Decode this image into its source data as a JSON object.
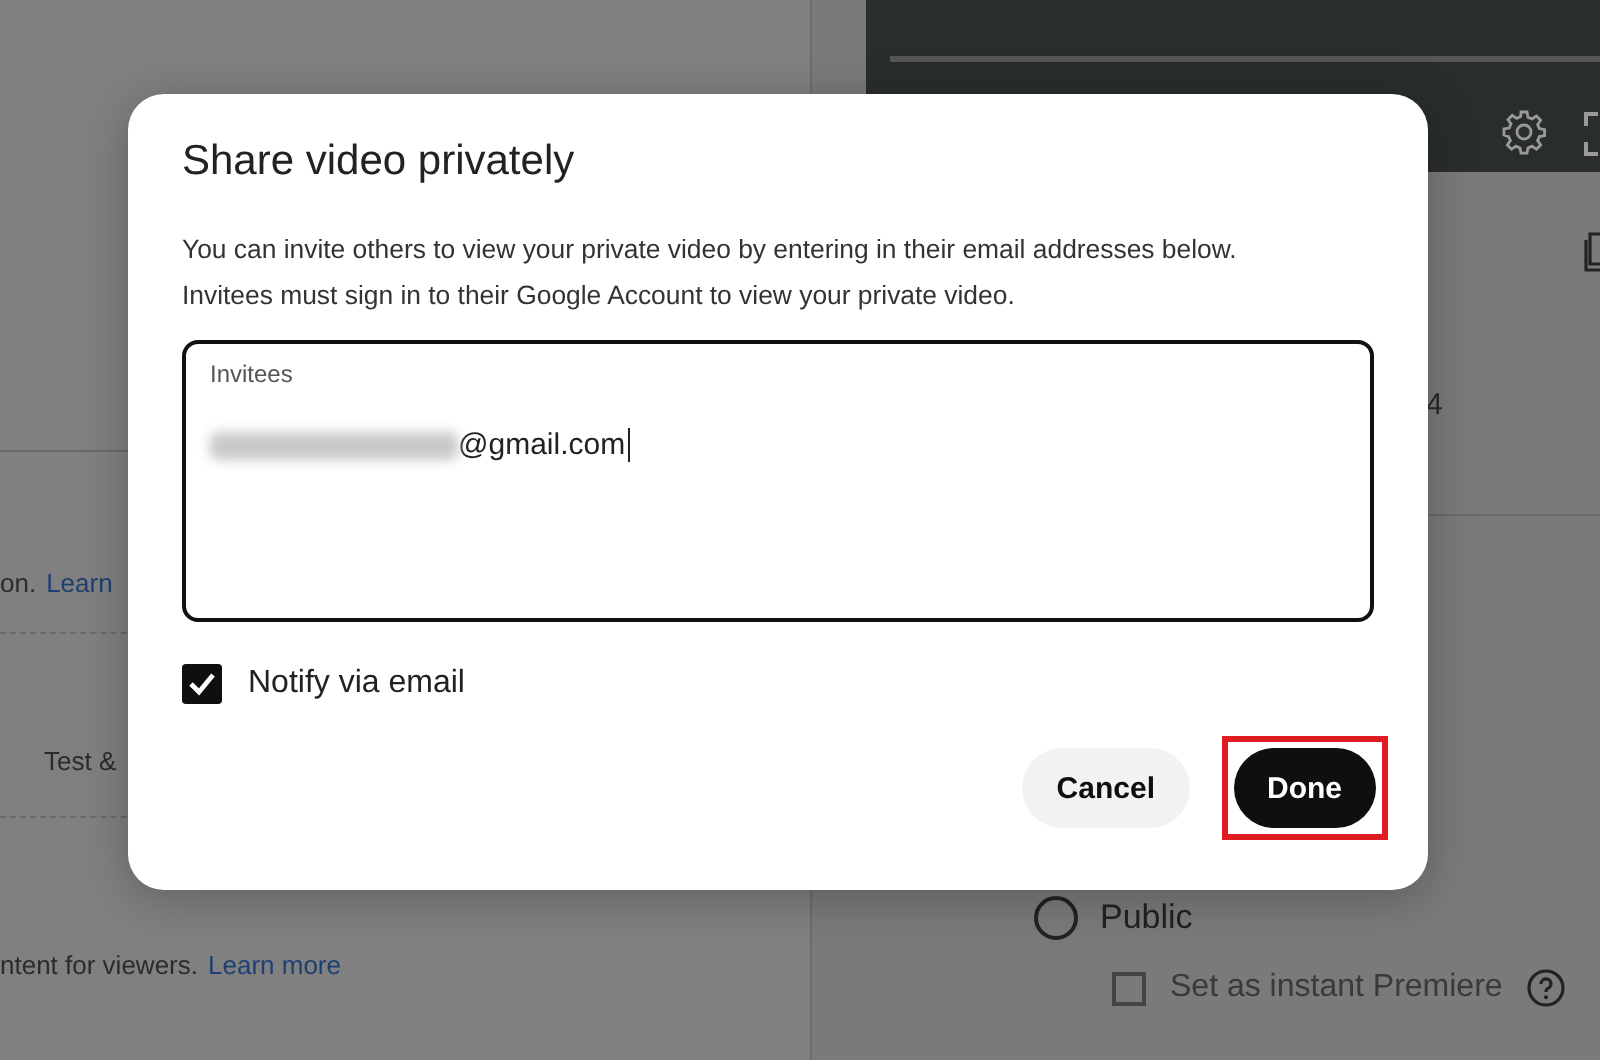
{
  "background": {
    "left": {
      "learn_snippet": {
        "text": "on.",
        "link": "Learn"
      },
      "test_label": "Test &",
      "footer": {
        "text": "ntent for viewers.",
        "link": "Learn more"
      }
    },
    "right": {
      "count": "4",
      "visibility_options": [
        {
          "label": "Public",
          "selected": false
        }
      ],
      "premiere": {
        "label": "Set as instant Premiere",
        "checked": false
      }
    }
  },
  "dialog": {
    "title": "Share video privately",
    "description": "You can invite others to view your private video by entering in their email addresses below. Invitees must sign in to their Google Account to view your private video.",
    "invitees": {
      "label": "Invitees",
      "value": "@gmail.com"
    },
    "notify": {
      "label": "Notify via email",
      "checked": true
    },
    "buttons": [
      {
        "label": "Cancel",
        "kind": "secondary",
        "highlighted": false
      },
      {
        "label": "Done",
        "kind": "primary",
        "highlighted": true
      }
    ]
  }
}
